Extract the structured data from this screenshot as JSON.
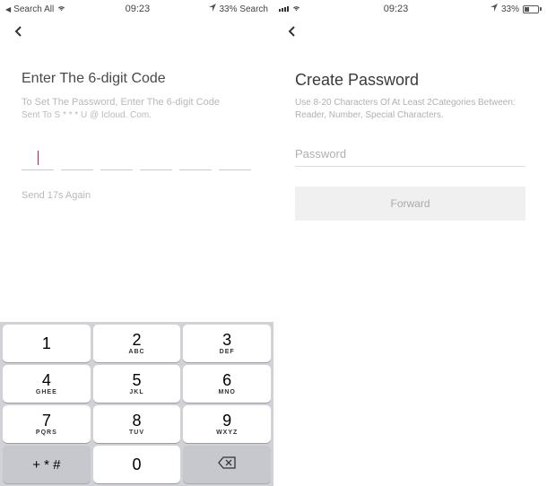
{
  "left": {
    "status": {
      "carrier": "Search All",
      "time": "09:23",
      "battery": "33% Search"
    },
    "title": "Enter The 6-digit Code",
    "subtitle": "To Set The Password, Enter The 6-digit Code",
    "subtitle2": "Sent To S * * * U @ Icloud. Com.",
    "resend": "Send 17s Again",
    "keypad": {
      "1": {
        "n": "1",
        "s": ""
      },
      "2": {
        "n": "2",
        "s": "ABC"
      },
      "3": {
        "n": "3",
        "s": "DEF"
      },
      "4": {
        "n": "4",
        "s": "Ghee"
      },
      "5": {
        "n": "5",
        "s": "JKL"
      },
      "6": {
        "n": "6",
        "s": "MNO"
      },
      "7": {
        "n": "7",
        "s": "PQRS"
      },
      "8": {
        "n": "8",
        "s": "TUV"
      },
      "9": {
        "n": "9",
        "s": "Wxyz"
      },
      "0": {
        "n": "0",
        "s": ""
      },
      "sym": "+ * #"
    }
  },
  "right": {
    "status": {
      "time": "09:23",
      "battery": "33%"
    },
    "title": "Create Password",
    "subtitle": "Use 8-20 Characters Of At Least 2Categories Between: Reader, Number, Special Characters.",
    "placeholder": "Password",
    "button": "Forward"
  }
}
